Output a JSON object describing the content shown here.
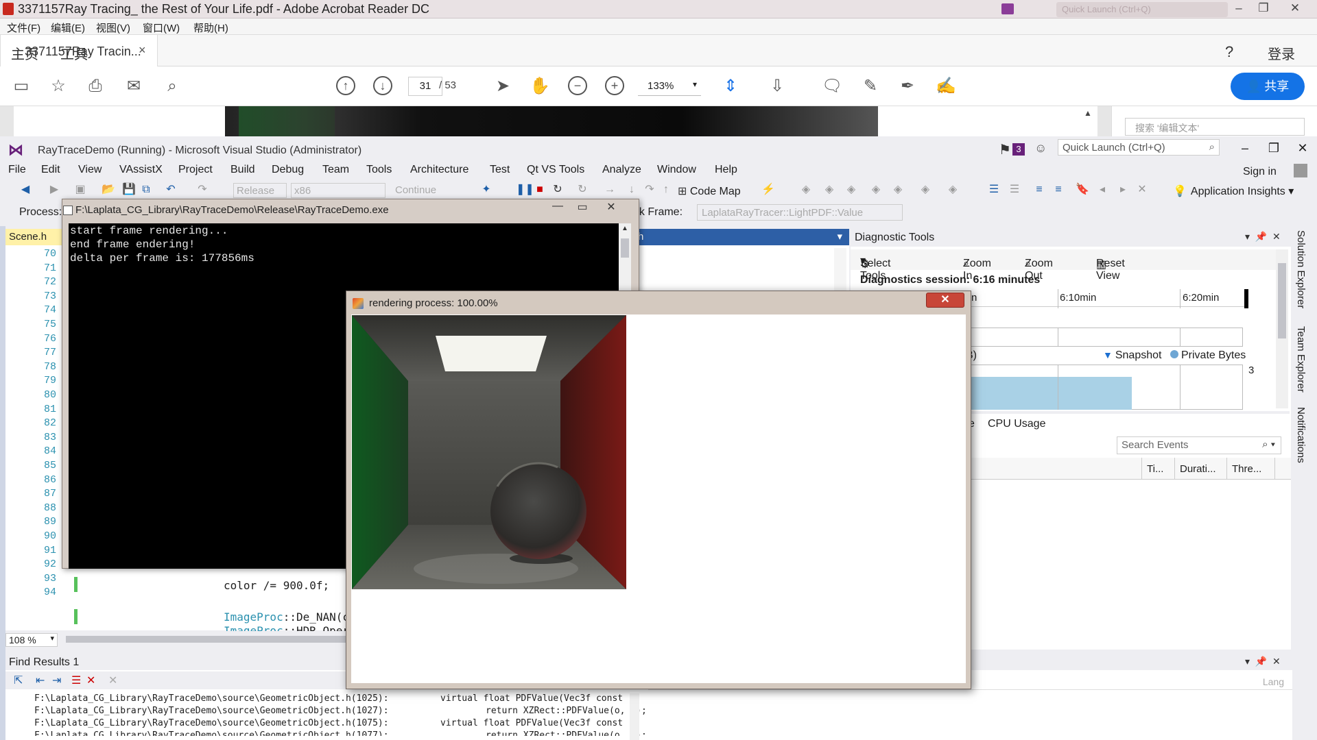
{
  "acrobat": {
    "title": "3371157Ray Tracing_ the Rest of Your Life.pdf - Adobe Acrobat Reader DC",
    "quick_launch": "Quick Launch (Ctrl+Q)",
    "menu": [
      "文件(F)",
      "编辑(E)",
      "视图(V)",
      "窗口(W)",
      "帮助(H)"
    ],
    "nav_home": "主页",
    "nav_tools": "工具",
    "doc_tab": "3371157Ray Tracin...",
    "login": "登录",
    "page_current": "31",
    "page_total": "/ 53",
    "zoom": "133%",
    "share": "共享",
    "search_placeholder": "搜索 '编辑文本'"
  },
  "vs": {
    "title": "RayTraceDemo (Running) - Microsoft Visual Studio (Administrator)",
    "notif_count": "3",
    "quick_launch": "Quick Launch (Ctrl+Q)",
    "menu": [
      "File",
      "Edit",
      "View",
      "VAssistX",
      "Project",
      "Build",
      "Debug",
      "Team",
      "Tools",
      "Architecture",
      "Test",
      "Qt VS Tools",
      "Analyze",
      "Window",
      "Help"
    ],
    "sign_in": "Sign in",
    "toolbar": {
      "config": "Release",
      "platform": "x86",
      "continue": "Continue",
      "code_map": "Code Map",
      "app_insights": "Application Insights"
    },
    "process_label": "Process:",
    "stack_label": "ack Frame:",
    "stack_value": "LaplataRayTracer::LightPDF::Value",
    "side_tabs": [
      "Solution Explorer",
      "Team Explorer",
      "Notifications"
    ]
  },
  "editor": {
    "tab": "Scene.h",
    "right_tab": "h",
    "line_numbers": [
      "70",
      "71",
      "72",
      "73",
      "74",
      "75",
      "76",
      "77",
      "78",
      "79",
      "80",
      "81",
      "82",
      "83",
      "84",
      "85",
      "86",
      "87",
      "88",
      "89",
      "90",
      "91",
      "92",
      "93",
      "94"
    ],
    "code": {
      "line91": "color /= 900.0f;",
      "line93_type": "ImageProc",
      "line93_rest": "::De_NAN(c",
      "line94_type": "ImageProc",
      "line94_rest": "::HDR_Oper"
    },
    "zoom": "108 %"
  },
  "diagnostics": {
    "title": "Diagnostic Tools",
    "select_tools": "Select Tools",
    "zoom_in": "Zoom In",
    "zoom_out": "Zoom Out",
    "reset_view": "Reset View",
    "session": "Diagnostics session: 6:16 minutes",
    "timeline": [
      "n",
      "6:10min",
      "6:20min"
    ],
    "legend_prefix": "B)",
    "snapshot": "Snapshot",
    "private_bytes": "Private Bytes",
    "axis_value": "3",
    "tab_prefix": "e",
    "cpu_usage": "CPU Usage",
    "search": "Search Events",
    "columns": [
      "Ti...",
      "Durati...",
      "Thre..."
    ]
  },
  "find_results": {
    "title": "Find Results 1",
    "lang": "Lang",
    "lines": [
      {
        "path": "F:\\Laplata_CG_Library\\RayTraceDemo\\source\\GeometricObject.h(1025):",
        "code": "virtual float PDFValue(Vec3f const"
      },
      {
        "path": "F:\\Laplata_CG_Library\\RayTraceDemo\\source\\GeometricObject.h(1027):",
        "code": "return XZRect::PDFValue(o, v);"
      },
      {
        "path": "F:\\Laplata_CG_Library\\RayTraceDemo\\source\\GeometricObject.h(1075):",
        "code": "virtual float PDFValue(Vec3f const"
      },
      {
        "path": "F:\\Laplata_CG_Library\\RayTraceDemo\\source\\GeometricObject.h(1077):",
        "code": "return XZRect::PDFValue(o, v);"
      }
    ]
  },
  "console": {
    "title": "F:\\Laplata_CG_Library\\RayTraceDemo\\Release\\RayTraceDemo.exe",
    "lines": [
      "start frame rendering...",
      "end frame endering!",
      "delta per frame is: 177856ms"
    ]
  },
  "render_window": {
    "title": "rendering process: 100.00%",
    "progress": 100,
    "close": "✕"
  },
  "colors": {
    "vs_purple": "#68217a",
    "acrobat_blue": "#1473e6",
    "wall_green": "#1d6b2a",
    "wall_red": "#7a1d1a"
  }
}
